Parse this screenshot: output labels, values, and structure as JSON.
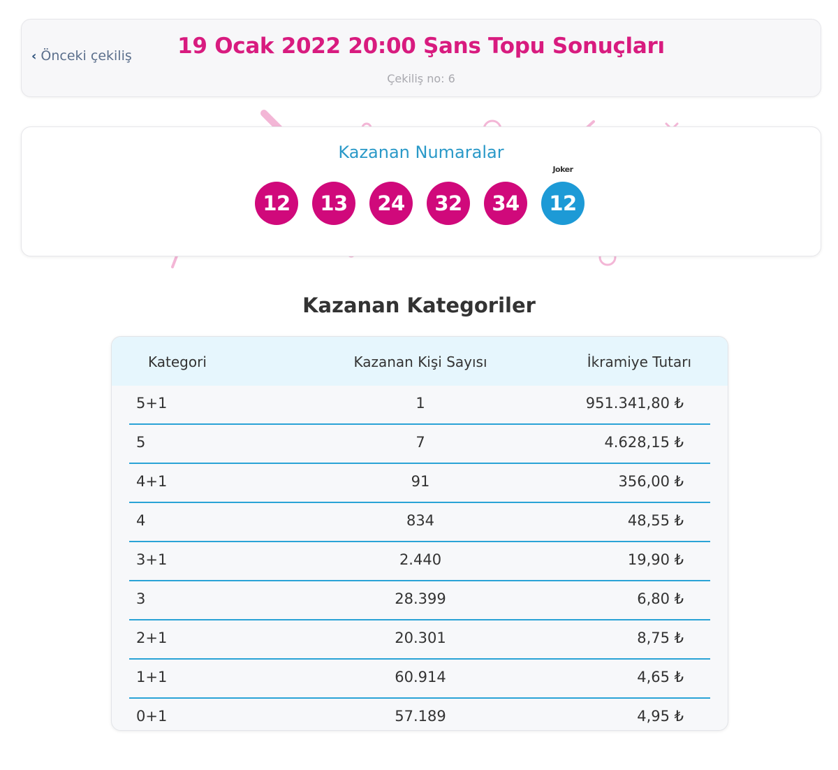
{
  "header": {
    "back_label": "Önceki çekiliş",
    "title": "19 Ocak 2022 20:00 Şans Topu Sonuçları",
    "draw_no": "Çekiliş no: 6"
  },
  "winning_numbers": {
    "title": "Kazanan Numaralar",
    "balls": [
      "12",
      "13",
      "24",
      "32",
      "34"
    ],
    "joker_label": "Joker",
    "joker": "12",
    "colors": {
      "ball": "#d0097b",
      "joker": "#1d9ad6"
    }
  },
  "categories": {
    "title": "Kazanan Kategoriler",
    "columns": [
      "Kategori",
      "Kazanan Kişi Sayısı",
      "İkramiye Tutarı"
    ],
    "rows": [
      {
        "cat": "5+1",
        "winners": "1",
        "prize": "951.341,80 ₺"
      },
      {
        "cat": "5",
        "winners": "7",
        "prize": "4.628,15 ₺"
      },
      {
        "cat": "4+1",
        "winners": "91",
        "prize": "356,00 ₺"
      },
      {
        "cat": "4",
        "winners": "834",
        "prize": "48,55 ₺"
      },
      {
        "cat": "3+1",
        "winners": "2.440",
        "prize": "19,90 ₺"
      },
      {
        "cat": "3",
        "winners": "28.399",
        "prize": "6,80 ₺"
      },
      {
        "cat": "2+1",
        "winners": "20.301",
        "prize": "8,75 ₺"
      },
      {
        "cat": "1+1",
        "winners": "60.914",
        "prize": "4,65 ₺"
      },
      {
        "cat": "0+1",
        "winners": "57.189",
        "prize": "4,95 ₺"
      }
    ]
  }
}
